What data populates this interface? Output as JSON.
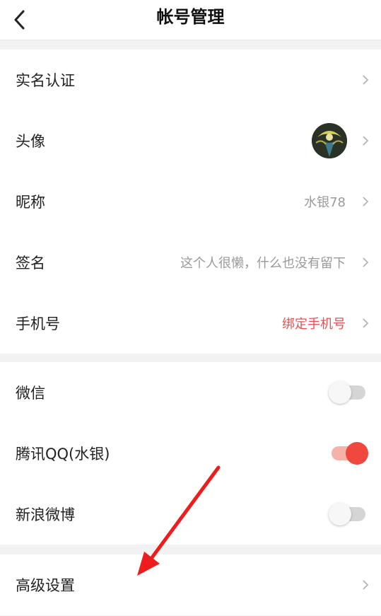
{
  "header": {
    "title": "帐号管理"
  },
  "profile": {
    "items": [
      {
        "label": "实名认证",
        "value": ""
      },
      {
        "label": "头像",
        "value": ""
      },
      {
        "label": "昵称",
        "value": "水银78"
      },
      {
        "label": "签名",
        "value": "这个人很懒，什么也没有留下"
      },
      {
        "label": "手机号",
        "value": "绑定手机号"
      }
    ]
  },
  "bindings": {
    "items": [
      {
        "label": "微信",
        "enabled": false
      },
      {
        "label": "腾讯QQ(水银)",
        "enabled": true
      },
      {
        "label": "新浪微博",
        "enabled": false
      }
    ]
  },
  "advanced": {
    "label": "高级设置"
  },
  "colors": {
    "accent_red": "#f0483e",
    "bind_phone_red": "#ef4d4d",
    "annotation_arrow": "#ee1c1c"
  }
}
